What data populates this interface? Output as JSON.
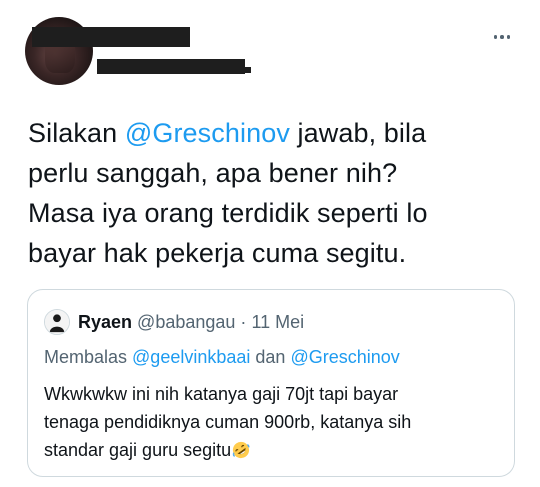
{
  "tweet": {
    "author_name": "",
    "author_handle": "",
    "more_icon": "ellipsis-icon",
    "text": {
      "l1_pre": "Silakan ",
      "l1_mention": "@Greschinov",
      "l1_post": " jawab, bila",
      "l2": "perlu sanggah, apa bener nih?",
      "l3": "Masa iya orang terdidik seperti lo",
      "l4": "bayar hak pekerja cuma segitu."
    }
  },
  "quote": {
    "name": "Ryaen",
    "handle": "@babangau",
    "separator": "·",
    "date": "11 Mei",
    "reply_prefix": "Membalas ",
    "reply_mention_1": "@geelvinkbaai",
    "reply_conj": " dan ",
    "reply_mention_2": "@Greschinov",
    "body": {
      "l1": "Wkwkwkw ini nih katanya gaji 70jt tapi bayar",
      "l2": "tenaga pendidiknya cuman 900rb, katanya sih",
      "l3": "standar gaji guru segitu"
    },
    "emoji": "rolling-on-floor-laughing-emoji"
  },
  "colors": {
    "link": "#1d9bf0",
    "text": "#0f1419",
    "secondary": "#536471",
    "border": "#cfd9de"
  }
}
